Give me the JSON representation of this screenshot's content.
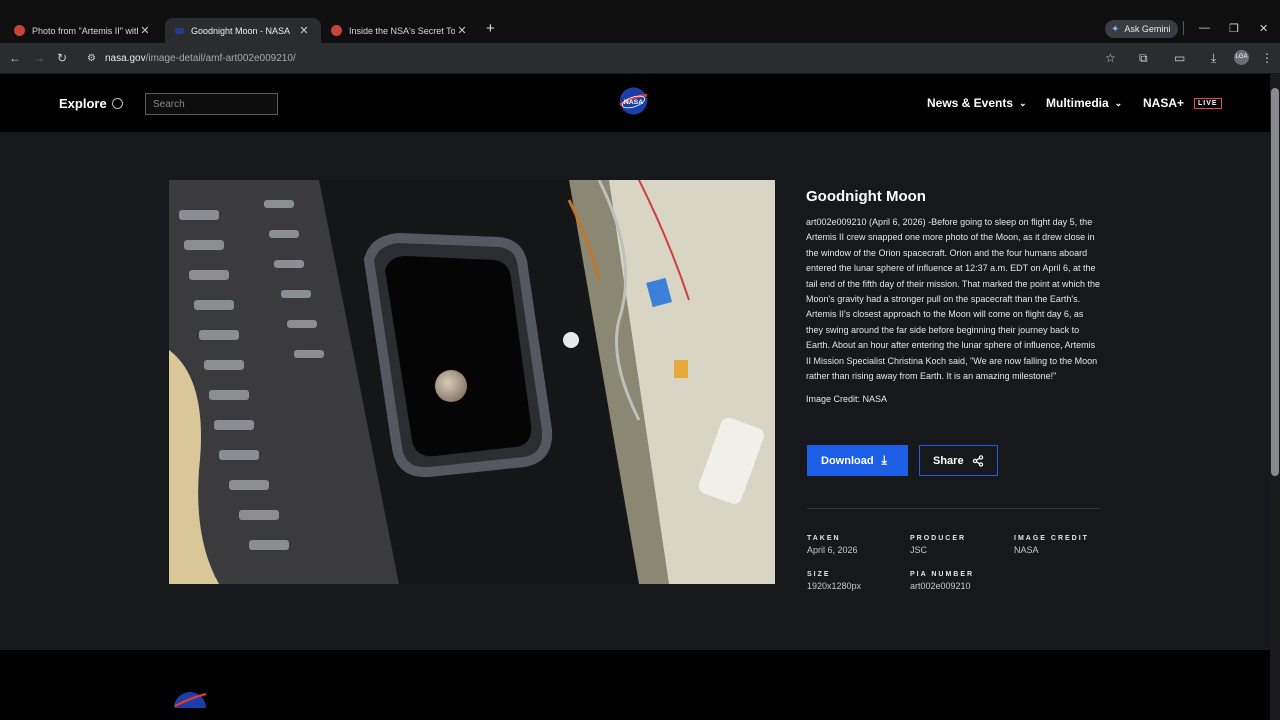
{
  "browser": {
    "tabs": [
      {
        "title": "Photo from \"Artemis II\" with n",
        "active": false
      },
      {
        "title": "Goodnight Moon - NASA",
        "active": true
      },
      {
        "title": "Inside the NSA's Secret Tool for",
        "active": false
      }
    ],
    "ask_gemini": "Ask Gemini",
    "url_host": "nasa.gov",
    "url_path": "/image-detail/amf-art002e009210/"
  },
  "header": {
    "explore": "Explore",
    "search_placeholder": "Search",
    "nav": [
      {
        "label": "News & Events"
      },
      {
        "label": "Multimedia"
      },
      {
        "label": "NASA+"
      }
    ],
    "live_badge": "LIVE"
  },
  "article": {
    "title": "Goodnight Moon",
    "description": "art002e009210 (April 6, 2026) -Before going to sleep on flight day 5, the Artemis II crew snapped one more photo of the Moon, as it drew close in the window of the Orion spacecraft. Orion and the four humans aboard entered the lunar sphere of influence at 12:37 a.m. EDT on April 6, at the tail end of the fifth day of their mission. That marked the point at which the Moon's gravity had a stronger pull on the spacecraft than the Earth's. Artemis II's closest approach to the Moon will come on flight day 6, as they swing around the far side before beginning their journey back to Earth. About an hour after entering the lunar sphere of influence, Artemis II Mission Specialist Christina Koch said, \"We are now falling to the Moon rather than rising away from Earth. It is an amazing milestone!\"",
    "credit": "Image Credit: NASA",
    "download_label": "Download",
    "share_label": "Share"
  },
  "metadata": {
    "taken_label": "TAKEN",
    "taken": "April 6, 2026",
    "producer_label": "PRODUCER",
    "producer": "JSC",
    "image_credit_label": "IMAGE CREDIT",
    "image_credit": "NASA",
    "size_label": "SIZE",
    "size": "1920x1280px",
    "pia_label": "PIA NUMBER",
    "pia": "art002e009210"
  },
  "colors": {
    "accent": "#1c5ee6",
    "live": "#e64b4b",
    "background": "#17181c"
  }
}
